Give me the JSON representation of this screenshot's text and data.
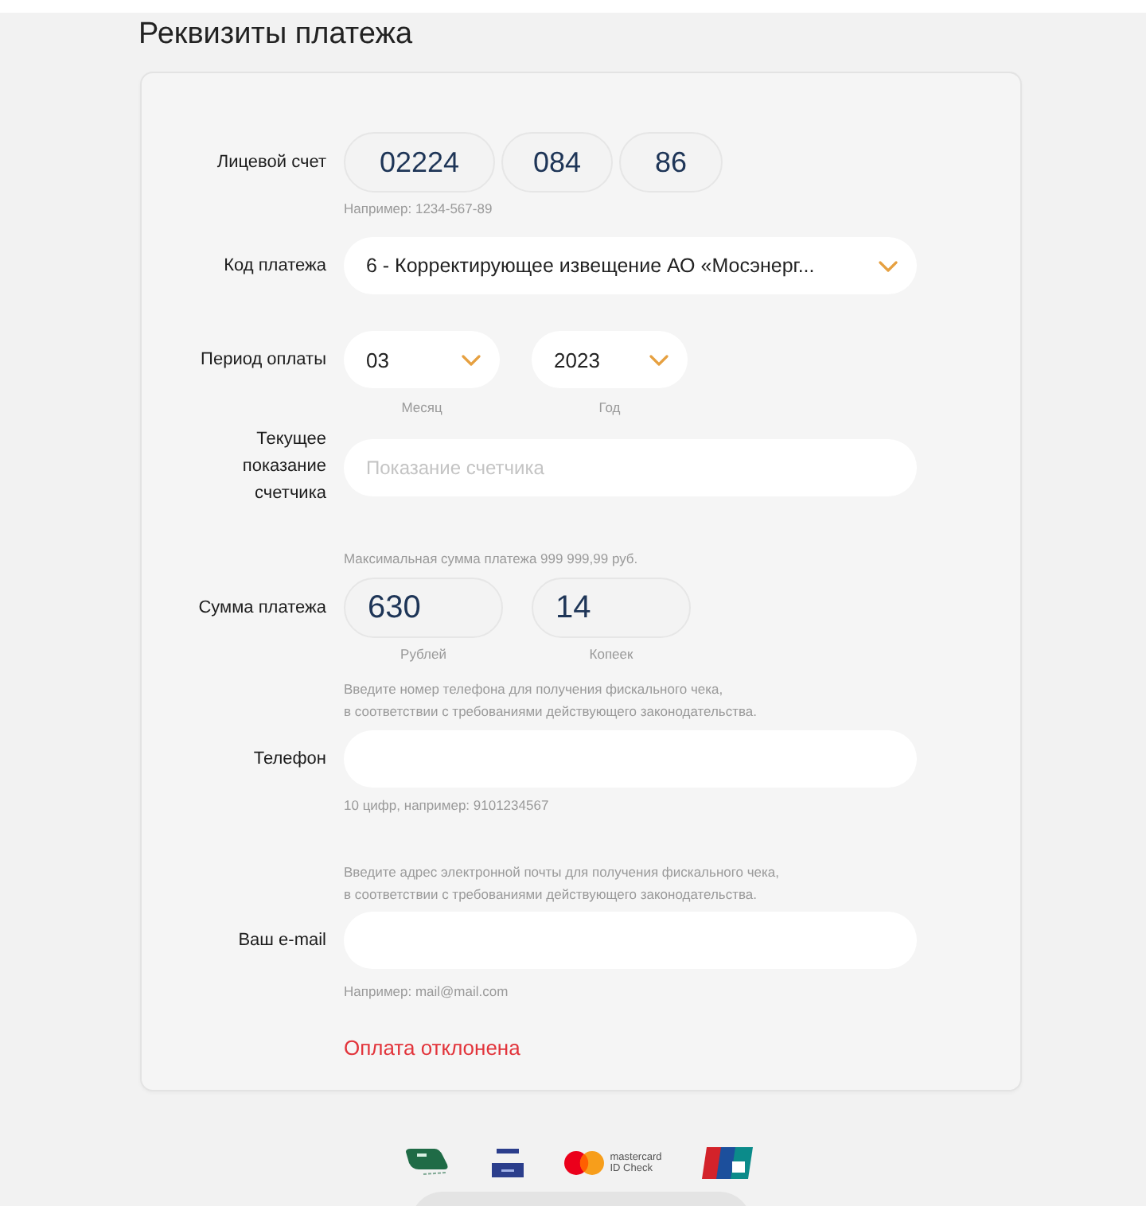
{
  "title": "Реквизиты платежа",
  "rows": [
    {
      "kind": "account",
      "label": "Лицевой счет",
      "segments": [
        {
          "value": "02224"
        },
        {
          "value": "084"
        },
        {
          "value": "86"
        }
      ],
      "hint_after": "Например: 1234-567-89"
    },
    {
      "kind": "select",
      "label": "Код платежа",
      "value": "6 - Корректирующее извещение АО «Мосэнерг..."
    },
    {
      "kind": "period",
      "label": "Период оплаты",
      "selects": [
        {
          "value": "03",
          "caption": "Месяц"
        },
        {
          "value": "2023",
          "caption": "Год"
        }
      ]
    },
    {
      "kind": "input",
      "label": "Текущее показание счетчика",
      "placeholder": "Показание счетчика"
    },
    {
      "kind": "amount",
      "label": "Сумма платежа",
      "hint_before": "Максимальная сумма платежа 999 999,99 руб.",
      "segments": [
        {
          "value": "630",
          "caption": "Рублей"
        },
        {
          "value": "14",
          "caption": "Копеек"
        }
      ]
    },
    {
      "kind": "input",
      "label": "Телефон",
      "hint_before": "Введите номер телефона для получения фискального чека,\nв соответствии с требованиями действующего законодательства.",
      "hint_after": "10 цифр, например: 9101234567"
    },
    {
      "kind": "input",
      "label": "Ваш e-mail",
      "hint_before": "Введите адрес электронной почты для получения фискального чека,\nв соответствии с требованиями действующего законодательства.",
      "hint_after": "Например: mail@mail.com"
    }
  ],
  "error": "Оплата отклонена",
  "payment_logos": [
    {
      "kind": "green_card"
    },
    {
      "kind": "blue_card"
    },
    {
      "kind": "circles",
      "caption": "mastercard\nID Check"
    },
    {
      "kind": "flag"
    }
  ]
}
